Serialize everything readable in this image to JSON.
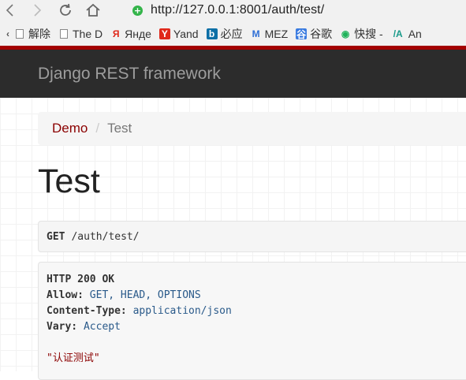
{
  "browser": {
    "url": "http://127.0.0.1:8001/auth/test/",
    "bookmarks": [
      {
        "label": "解除",
        "icon": "page-icon"
      },
      {
        "label": "The D",
        "icon": "page-icon"
      },
      {
        "label": "Янде",
        "icon": "yandex-icon"
      },
      {
        "label": "Yand",
        "icon": "yandex-y-icon"
      },
      {
        "label": "必应",
        "icon": "bing-icon"
      },
      {
        "label": "MEZ",
        "icon": "m-icon"
      },
      {
        "label": "谷歌",
        "icon": "google-icon"
      },
      {
        "label": "快搜 -",
        "icon": "kuaisou-icon"
      },
      {
        "label": "An",
        "icon": "a-icon"
      }
    ]
  },
  "navbar": {
    "brand": "Django REST framework"
  },
  "breadcrumb": {
    "link": "Demo",
    "separator": "/",
    "active": "Test"
  },
  "page": {
    "title": "Test"
  },
  "request": {
    "method": "GET",
    "path": "/auth/test/"
  },
  "response": {
    "status": "HTTP 200 OK",
    "headers": [
      {
        "key": "Allow:",
        "value": "GET, HEAD, OPTIONS"
      },
      {
        "key": "Content-Type:",
        "value": "application/json"
      },
      {
        "key": "Vary:",
        "value": "Accept"
      }
    ],
    "body": "\"认证测试\""
  },
  "colors": {
    "navbar": "#2c2c2c",
    "accent_line": "#a30000",
    "link": "#8b0000"
  }
}
